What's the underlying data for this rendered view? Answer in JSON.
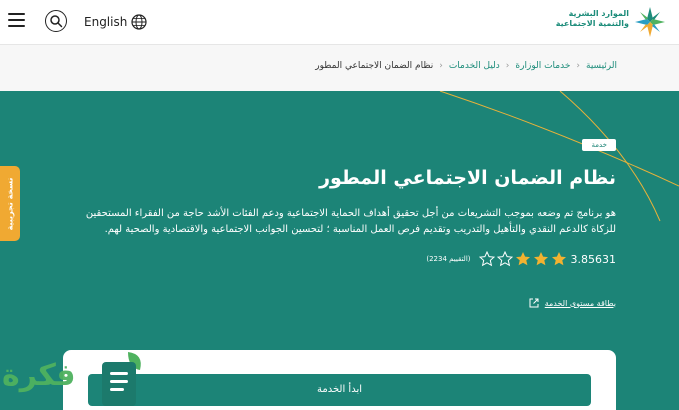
{
  "header": {
    "language_label": "English",
    "logo_line1": "الموارد البشرية",
    "logo_line2": "والتنمية الاجتماعية"
  },
  "breadcrumb": {
    "items": [
      "الرئيسية",
      "خدمات الوزارة",
      "دليل الخدمات"
    ],
    "current": "نظام الضمان الاجتماعي المطور"
  },
  "service": {
    "tag": "خدمة",
    "title": "نظام الضمان الاجتماعي المطور",
    "description": "هو برنامج تم وضعه بموجب التشريعات من أجل تحقيق أهداف الحماية الاجتماعية ودعم الفئات الأشد حاجة من الفقراء المستحقين للزكاة كالدعم النقدي والتأهيل والتدريب وتقديم فرص العمل المناسبة ؛ لتحسين الجوانب الاجتماعية والاقتصادية والصحية لهم.",
    "rating_value": "3.85631",
    "rating": 3.85631,
    "rating_count": "(التقييم 2234)",
    "card_link": "بطاقة مستوى الخدمة",
    "start_button": "ابدأ الخدمة"
  },
  "side_tab": {
    "label": "نسخة تجريبية"
  },
  "watermark": {
    "text": "فكرة"
  },
  "colors": {
    "primary": "#1c8477",
    "star_filled": "#f2b230",
    "side_tab": "#f0a932",
    "accent_line": "#e8b23a"
  }
}
